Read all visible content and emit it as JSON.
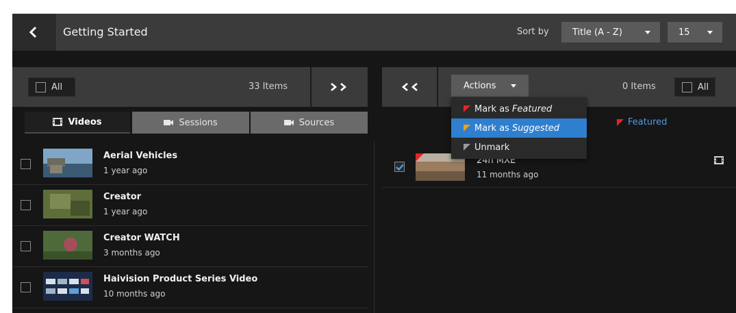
{
  "header": {
    "title": "Getting Started",
    "sort_label": "Sort by",
    "sort_value": "Title (A - Z)",
    "page_size": "15"
  },
  "left_panel": {
    "all_label": "All",
    "items_count": "33 Items",
    "tabs": [
      {
        "label": "Videos",
        "icon": "film-icon",
        "active": true
      },
      {
        "label": "Sessions",
        "icon": "camera-icon",
        "active": false
      },
      {
        "label": "Sources",
        "icon": "video-camera-icon",
        "active": false
      }
    ],
    "rows": [
      {
        "title": "Aerial Vehicles",
        "subtitle": "1 year ago"
      },
      {
        "title": "Creator",
        "subtitle": "1 year ago"
      },
      {
        "title": "Creator WATCH",
        "subtitle": "3 months ago"
      },
      {
        "title": "Haivision Product Series Video",
        "subtitle": "10 months ago"
      }
    ]
  },
  "right_panel": {
    "actions_label": "Actions",
    "items_count": "0 Items",
    "all_label": "All",
    "legend_featured": "Featured",
    "rows": [
      {
        "title": "24h MXE",
        "subtitle": "11 months ago",
        "checked": true
      }
    ]
  },
  "actions_menu": {
    "items": [
      {
        "prefix": "Mark as",
        "emph": "Featured",
        "flag_color": "#e32626",
        "highlighted": false
      },
      {
        "prefix": "Mark as",
        "emph": "Suggested",
        "flag_color": "#f2a01c",
        "highlighted": true
      },
      {
        "prefix": "Unmark",
        "emph": "",
        "flag_color": "#9a9a9a",
        "highlighted": false
      }
    ]
  },
  "colors": {
    "accent": "#2e7fd0",
    "featured": "#e32626",
    "suggested": "#f2a01c"
  }
}
